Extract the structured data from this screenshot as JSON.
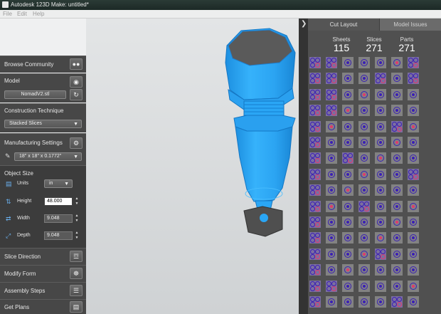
{
  "window": {
    "title": "Autodesk 123D Make: untitled*"
  },
  "menu": [
    "File",
    "Edit",
    "Help"
  ],
  "left_panel": {
    "browse_community": "Browse Community",
    "model": {
      "title": "Model",
      "file": "NomadV2.stl"
    },
    "construction": {
      "title": "Construction Technique",
      "value": "Stacked Slices"
    },
    "manufacturing": {
      "title": "Manufacturing Settings",
      "value": "18\" x 18\" x 0.1772\""
    },
    "object_size": {
      "title": "Object Size",
      "units_label": "Units",
      "units_value": "in",
      "height_label": "Height",
      "height_value": "48.000",
      "width_label": "Width",
      "width_value": "9.048",
      "depth_label": "Depth",
      "depth_value": "9.048"
    },
    "slice_direction": "Slice Direction",
    "modify_form": "Modify Form",
    "assembly_steps": "Assembly Steps",
    "get_plans": "Get Plans"
  },
  "right_panel": {
    "tabs": [
      "Cut Layout",
      "Model Issues"
    ],
    "active_tab": "Cut Layout",
    "stats": [
      {
        "label": "Sheets",
        "value": "115"
      },
      {
        "label": "Slices",
        "value": "271"
      },
      {
        "label": "Parts",
        "value": "271"
      }
    ]
  },
  "colors": {
    "model_blue": "#2aa6f5",
    "panel_dark": "#474747",
    "slice_outline": "#3a1fb5",
    "slice_red": "#e23a6a"
  },
  "icons": [
    "community-icon",
    "eye-icon",
    "refresh-icon",
    "gear-icon",
    "pencil-icon",
    "units-icon",
    "height-icon",
    "width-icon",
    "depth-icon",
    "slice-direction-icon",
    "modify-form-icon",
    "assembly-icon",
    "plans-icon",
    "collapse-arrow-icon"
  ]
}
